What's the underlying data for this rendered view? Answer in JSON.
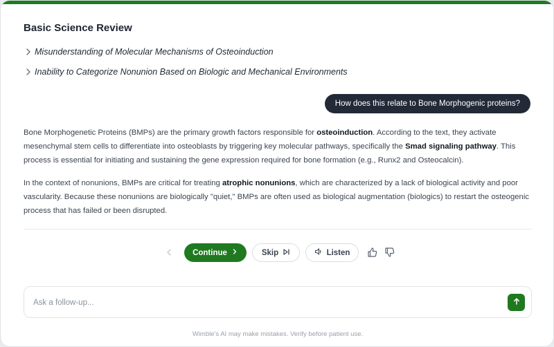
{
  "colors": {
    "accent": "#1f7a1f",
    "user_bubble": "#222a38"
  },
  "header": {
    "title": "Basic Science Review"
  },
  "topics": [
    {
      "label": "Misunderstanding of Molecular Mechanisms of Osteoinduction",
      "icon": "chevron-right-icon"
    },
    {
      "label": "Inability to Categorize Nonunion Based on Biologic and Mechanical Environments",
      "icon": "chevron-right-icon"
    }
  ],
  "user_message": "How does this relate to Bone Morphogenic proteins?",
  "response": {
    "p1": {
      "t1": "Bone Morphogenetic Proteins (BMPs) are the primary growth factors responsible for ",
      "b1": "osteoinduction",
      "t2": ". According to the text, they activate mesenchymal stem cells to differentiate into osteoblasts by triggering key molecular pathways, specifically the ",
      "b2": "Smad signaling pathway",
      "t3": ". This process is essential for initiating and sustaining the gene expression required for bone formation (e.g., Runx2 and Osteocalcin)."
    },
    "p2": {
      "t1": "In the context of nonunions, BMPs are critical for treating ",
      "b1": "atrophic nonunions",
      "t2": ", which are characterized by a lack of biological activity and poor vascularity. Because these nonunions are biologically \"quiet,\" BMPs are often used as biological augmentation (biologics) to restart the osteogenic process that has failed or been disrupted."
    }
  },
  "controls": {
    "continue_label": "Continue",
    "skip_label": "Skip",
    "listen_label": "Listen"
  },
  "composer": {
    "placeholder": "Ask a follow-up..."
  },
  "footer": {
    "disclaimer": "Wimble's AI may make mistakes. Verify before patient use."
  }
}
